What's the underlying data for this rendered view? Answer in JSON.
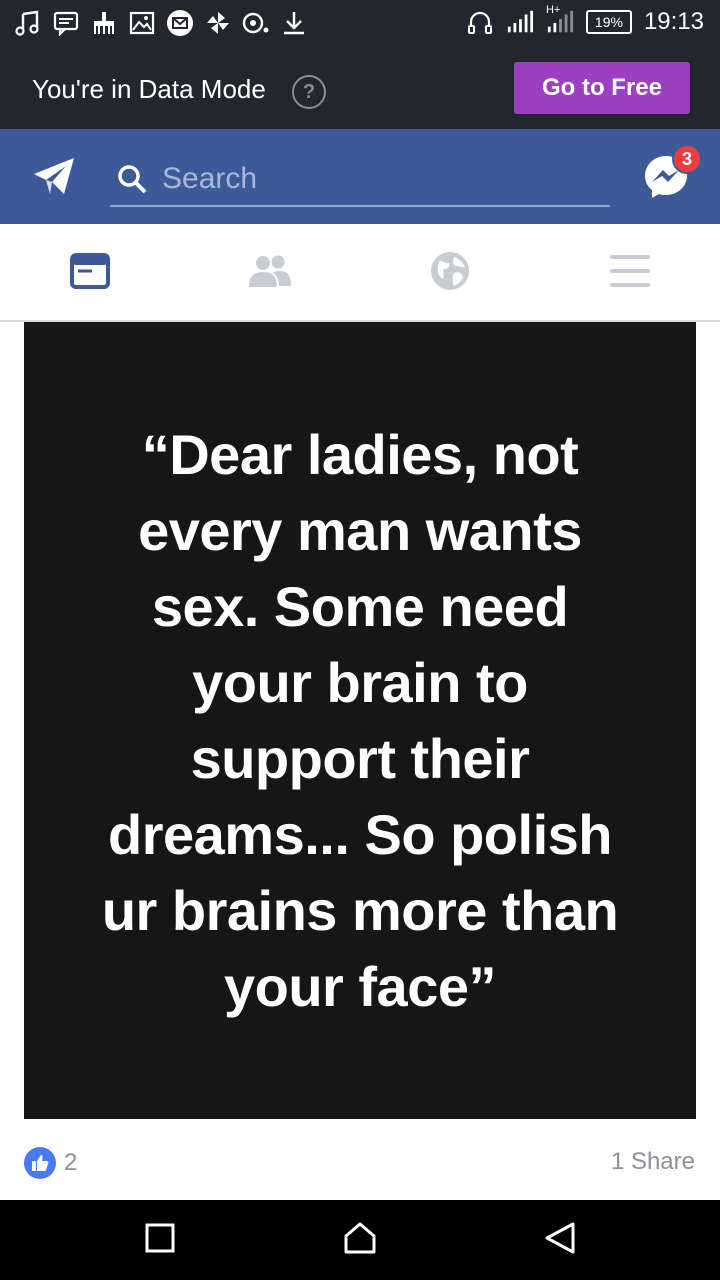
{
  "status_bar": {
    "time": "19:13",
    "battery": "19%",
    "network": "H+",
    "left_icons": [
      "music-icon",
      "message-icon",
      "cleaner-icon",
      "gallery-icon",
      "email-icon",
      "pinwheel-icon",
      "record-icon",
      "download-icon"
    ],
    "right_icons": [
      "headphones-icon",
      "signal-icon",
      "signal-hplus-icon",
      "battery-icon"
    ]
  },
  "data_mode": {
    "text": "You're in Data Mode",
    "help": "?",
    "button": "Go to Free",
    "button_color": "#9c3fc1"
  },
  "header": {
    "search_placeholder": "Search",
    "messenger_badge": "3",
    "brand_color": "#3d5a98"
  },
  "tabs": [
    {
      "name": "news-feed",
      "icon": "news-feed-icon",
      "active": true
    },
    {
      "name": "friends",
      "icon": "friends-icon",
      "active": false
    },
    {
      "name": "notifications",
      "icon": "globe-icon",
      "active": false
    },
    {
      "name": "menu",
      "icon": "menu-icon",
      "active": false
    }
  ],
  "post": {
    "quote_lines": [
      "“Dear ladies, not",
      "every man wants",
      "sex. Some need",
      "your brain to",
      "support their",
      "dreams... So polish",
      "ur brains more than",
      "your face”"
    ],
    "likes": "2",
    "shares": "1 Share"
  },
  "nav": [
    "recents-icon",
    "home-icon",
    "back-icon"
  ]
}
